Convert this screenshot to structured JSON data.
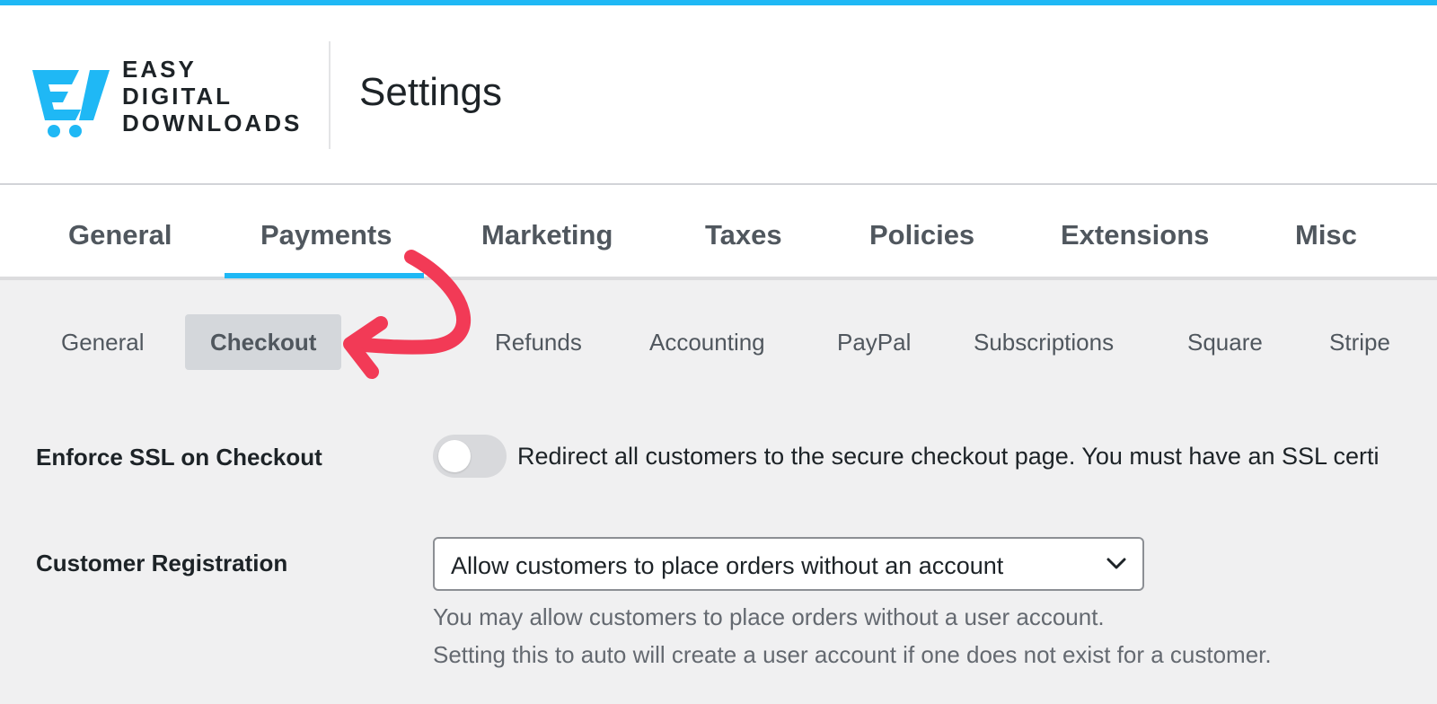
{
  "brand": {
    "line1": "EASY",
    "line2": "DIGITAL",
    "line3": "DOWNLOADS",
    "accent_color": "#1fb8f5"
  },
  "page": {
    "title": "Settings"
  },
  "tabs": [
    {
      "label": "General",
      "active": false
    },
    {
      "label": "Payments",
      "active": true
    },
    {
      "label": "Marketing",
      "active": false
    },
    {
      "label": "Taxes",
      "active": false
    },
    {
      "label": "Policies",
      "active": false
    },
    {
      "label": "Extensions",
      "active": false
    },
    {
      "label": "Misc",
      "active": false
    }
  ],
  "subtabs": [
    {
      "label": "General",
      "active": false
    },
    {
      "label": "Checkout",
      "active": true
    },
    {
      "label": "Refunds",
      "active": false
    },
    {
      "label": "Accounting",
      "active": false
    },
    {
      "label": "PayPal",
      "active": false
    },
    {
      "label": "Subscriptions",
      "active": false
    },
    {
      "label": "Square",
      "active": false
    },
    {
      "label": "Stripe",
      "active": false
    }
  ],
  "settings": {
    "ssl": {
      "label": "Enforce SSL on Checkout",
      "enabled": false,
      "description": "Redirect all customers to the secure checkout page. You must have an SSL certi"
    },
    "registration": {
      "label": "Customer Registration",
      "selected": "Allow customers to place orders without an account",
      "help1": "You may allow customers to place orders without a user account.",
      "help2": "Setting this to auto will create a user account if one does not exist for a customer."
    }
  },
  "annotation": {
    "icon": "curved-arrow-icon",
    "color": "#f23a56"
  }
}
